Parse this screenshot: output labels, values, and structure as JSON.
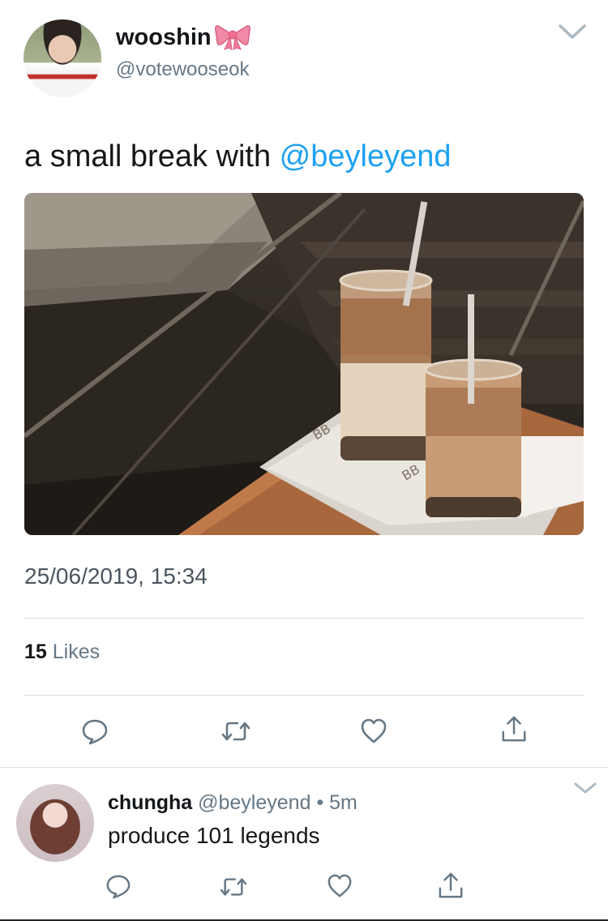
{
  "tweet": {
    "author_name": "wooshin",
    "author_handle": "@votewooseok",
    "text_prefix": "a small break with ",
    "mention": "@beyleyend",
    "timestamp": "25/06/2019, 15:34",
    "likes_count": "15",
    "likes_label": "Likes",
    "name_emoji": "bow-icon",
    "actions": [
      "reply-icon",
      "retweet-icon",
      "like-icon",
      "share-icon"
    ]
  },
  "reply": {
    "author_name": "chungha",
    "author_handle": "@beyleyend",
    "separator": "•",
    "time": "5m",
    "text": "produce 101 legends",
    "actions": [
      "reply-icon",
      "retweet-icon",
      "like-icon",
      "share-icon"
    ]
  },
  "colors": {
    "link": "#1da1f2",
    "secondary_text": "#657786",
    "icon": "#657786",
    "divider": "#d8dde2",
    "bow": "#f08aa6"
  }
}
